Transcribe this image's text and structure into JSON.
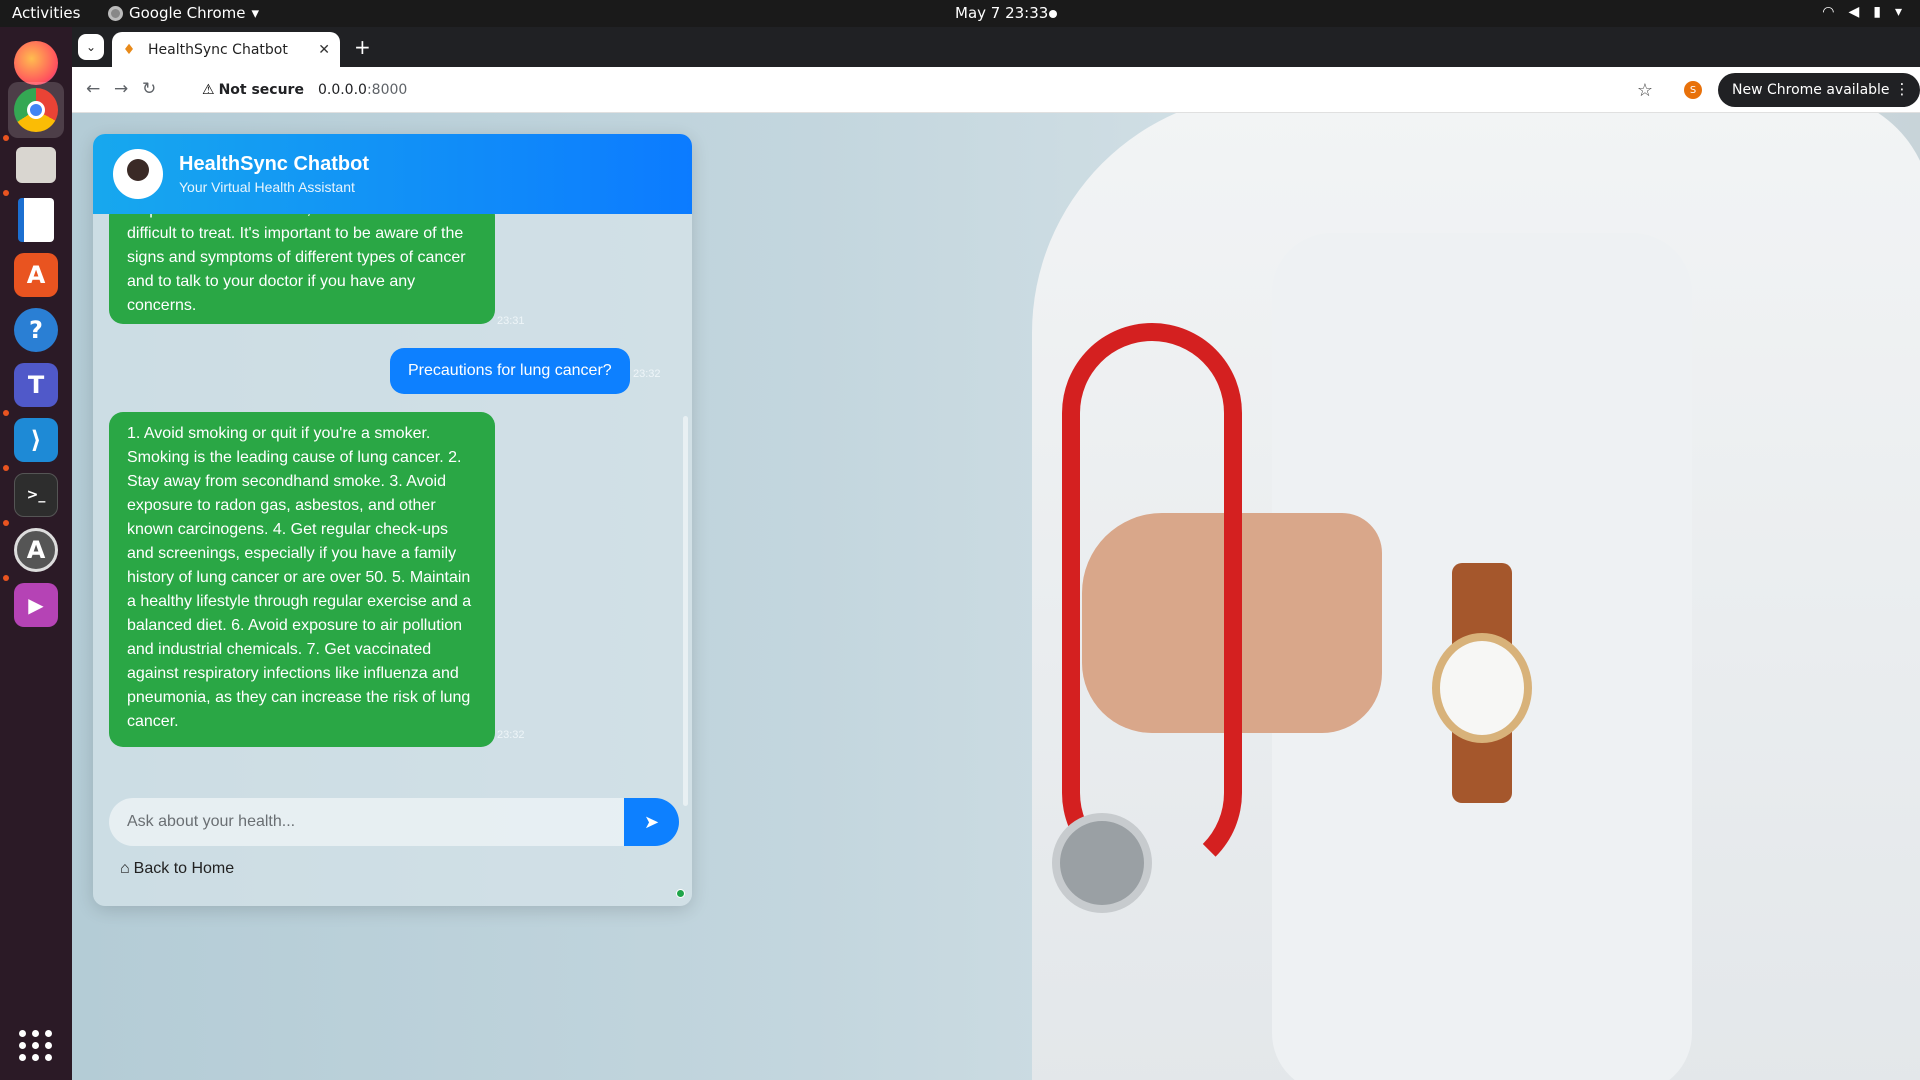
{
  "topbar": {
    "activities": "Activities",
    "app_menu": "Google Chrome",
    "clock": "May 7  23:33"
  },
  "dock": {
    "items": [
      {
        "name": "firefox",
        "color": "#ff7139",
        "glyph": "🦊"
      },
      {
        "name": "chrome",
        "color": "#4285f4",
        "glyph": "◉"
      },
      {
        "name": "files",
        "color": "#8a8a8a",
        "glyph": "▤"
      },
      {
        "name": "writer",
        "color": "#1c6fd1",
        "glyph": "▦"
      },
      {
        "name": "app-center",
        "color": "#e95420",
        "glyph": "A"
      },
      {
        "name": "help",
        "color": "#2a7fd4",
        "glyph": "?"
      },
      {
        "name": "teams",
        "color": "#5059c9",
        "glyph": "T"
      },
      {
        "name": "vscode",
        "color": "#1e8ad6",
        "glyph": "⟩"
      },
      {
        "name": "terminal",
        "color": "#2d2d2d",
        "glyph": ">_"
      },
      {
        "name": "updater",
        "color": "#444",
        "glyph": "A"
      },
      {
        "name": "media",
        "color": "#b543b5",
        "glyph": "▶"
      }
    ]
  },
  "browser": {
    "tab_title": "HealthSync Chatbot",
    "security": "Not secure",
    "url_host": "0.0.0.0",
    "url_port": ":8000",
    "profile_initial": "S",
    "update_label": "New Chrome available"
  },
  "chat": {
    "title": "HealthSync Chatbot",
    "subtitle": "Your Virtual Health Assistant",
    "messages": [
      {
        "role": "bot",
        "text": "respond well to treatment, while others are more difficult to treat. It's important to be aware of the signs and symptoms of different types of cancer and to talk to your doctor if you have any concerns.",
        "time": "23:31"
      },
      {
        "role": "user",
        "text": "Precautions for lung cancer?",
        "time": "23:32"
      },
      {
        "role": "bot",
        "text": "1. Avoid smoking or quit if you're a smoker. Smoking is the leading cause of lung cancer. 2. Stay away from secondhand smoke. 3. Avoid exposure to radon gas, asbestos, and other known carcinogens. 4. Get regular check-ups and screenings, especially if you have a family history of lung cancer or are over 50. 5. Maintain a healthy lifestyle through regular exercise and a balanced diet. 6. Avoid exposure to air pollution and industrial chemicals. 7. Get vaccinated against respiratory infections like influenza and pneumonia, as they can increase the risk of lung cancer.",
        "time": "23:32"
      }
    ],
    "input_placeholder": "Ask about your health...",
    "back_link": "Back to Home"
  },
  "colors": {
    "bot_bubble": "#2aa745",
    "user_bubble": "#0d80ff",
    "header": "#0c7bff"
  }
}
